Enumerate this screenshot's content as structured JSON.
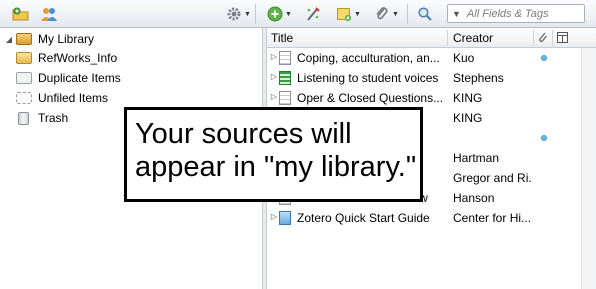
{
  "toolbar": {
    "icons": [
      "new-collection-icon",
      "new-group-icon",
      "gear-icon",
      "new-item-icon",
      "add-by-identifier-icon",
      "new-note-icon",
      "attachment-icon",
      "locate-icon"
    ],
    "search_placeholder": "All Fields & Tags"
  },
  "sidebar": {
    "items": [
      {
        "label": "My Library",
        "icon": "library-folder-icon",
        "expanded": true
      },
      {
        "label": "RefWorks_Info",
        "icon": "folder-icon"
      },
      {
        "label": "Duplicate Items",
        "icon": "duplicate-icon"
      },
      {
        "label": "Unfiled Items",
        "icon": "unfiled-icon"
      },
      {
        "label": "Trash",
        "icon": "trash-icon"
      }
    ]
  },
  "items_pane": {
    "columns": {
      "title": "Title",
      "creator": "Creator"
    },
    "rows": [
      {
        "title": "Coping, acculturation, an...",
        "creator": "Kuo",
        "icon": "document-icon",
        "has_attachment": true
      },
      {
        "title": "Listening to student voices",
        "creator": "Stephens",
        "icon": "spreadsheet-icon",
        "has_attachment": false
      },
      {
        "title": "Oper & Closed Questions...",
        "creator": "KING",
        "icon": "document-icon",
        "has_attachment": false
      },
      {
        "title": "...s...",
        "creator": "KING",
        "icon": "document-icon",
        "has_attachment": false
      },
      {
        "title": "",
        "creator": "",
        "icon": "document-icon",
        "has_attachment": true
      },
      {
        "title": "",
        "creator": "Hartman",
        "icon": "document-icon",
        "has_attachment": false
      },
      {
        "title": "...n...",
        "creator": "Gregor and Ri...",
        "icon": "document-icon",
        "has_attachment": false
      },
      {
        "title": "The Reference Interview",
        "creator": "Hanson",
        "icon": "document-icon",
        "has_attachment": false
      },
      {
        "title": "Zotero Quick Start Guide",
        "creator": "Center for Hi...",
        "icon": "web-page-icon",
        "has_attachment": false
      }
    ]
  },
  "callout": {
    "line1": "Your sources will",
    "line2": "appear in \"my library.\""
  },
  "colors": {
    "accent": "#6ab9e6",
    "folder": "#e8b84a",
    "callout_border": "#000000"
  }
}
